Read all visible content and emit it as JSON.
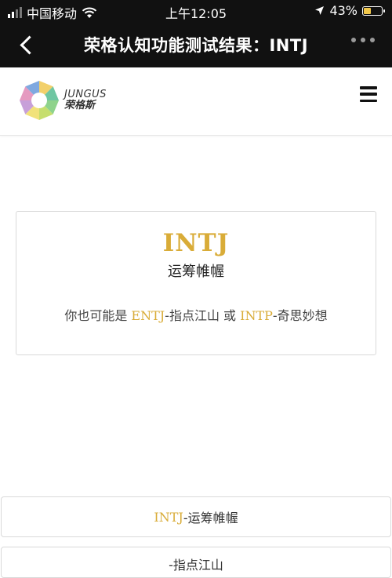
{
  "status_bar": {
    "carrier": "中国移动",
    "time": "上午12:05",
    "battery": "43%",
    "battery_level": 0.43,
    "icons": [
      "signal-icon",
      "wifi-icon",
      "location-icon",
      "battery-icon"
    ]
  },
  "nav_bar": {
    "title": "荣格认知功能测试结果：INTJ",
    "back_icon": "chevron-left-icon",
    "more_icon": "more-icon"
  },
  "header": {
    "logo_en": "JUNGUS",
    "logo_zh": "荣格斯",
    "menu_icon": "hamburger-icon"
  },
  "result": {
    "type_code": "INTJ",
    "type_name": "运筹帷幄",
    "maybe_prefix": "你也可能是 ",
    "alt1_code": "ENTJ",
    "alt1_name": "-指点江山",
    "connector": " 或 ",
    "alt2_code": "INTP",
    "alt2_name": "-奇思妙想"
  },
  "list": [
    {
      "code": "INTJ",
      "name": "-运筹帷幄"
    },
    {
      "code": "",
      "name": "-指点江山"
    }
  ],
  "colors": {
    "accent": "#d9ac38",
    "topbar": "#111111"
  }
}
